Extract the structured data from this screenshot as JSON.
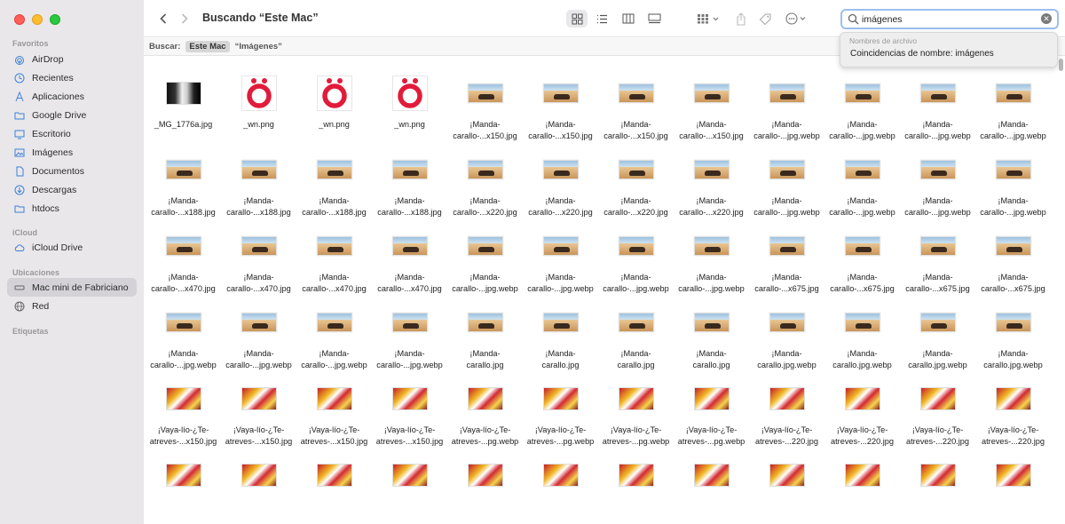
{
  "window": {
    "title": "Buscando “Este Mac”"
  },
  "sidebar": {
    "sections": [
      {
        "label": "Favoritos"
      },
      {
        "label": "iCloud"
      },
      {
        "label": "Ubicaciones"
      },
      {
        "label": "Etiquetas"
      }
    ],
    "favorites": [
      {
        "label": "AirDrop",
        "icon": "airdrop-icon"
      },
      {
        "label": "Recientes",
        "icon": "clock-icon"
      },
      {
        "label": "Aplicaciones",
        "icon": "applications-icon"
      },
      {
        "label": "Google Drive",
        "icon": "folder-icon"
      },
      {
        "label": "Escritorio",
        "icon": "desktop-icon"
      },
      {
        "label": "Imágenes",
        "icon": "photo-icon"
      },
      {
        "label": "Documentos",
        "icon": "document-icon"
      },
      {
        "label": "Descargas",
        "icon": "download-icon"
      },
      {
        "label": "htdocs",
        "icon": "folder-icon"
      }
    ],
    "icloud": [
      {
        "label": "iCloud Drive",
        "icon": "cloud-icon"
      }
    ],
    "locations": [
      {
        "label": "Mac mini de Fabriciano",
        "icon": "mac-mini-icon",
        "selected": true
      },
      {
        "label": "Red",
        "icon": "network-icon"
      }
    ]
  },
  "search": {
    "value": "imágenes",
    "suggestion_header": "Nombres de archivo",
    "suggestion": "Coincidencias de nombre: imágenes"
  },
  "scope": {
    "label": "Buscar:",
    "selected": "Este Mac",
    "option": "“Imágenes”"
  },
  "files": [
    {
      "name": "_MG_1776a.jpg",
      "thumb": "face"
    },
    {
      "name": "_wn.png",
      "thumb": "o"
    },
    {
      "name": "_wn.png",
      "thumb": "o"
    },
    {
      "name": "_wn.png",
      "thumb": "o"
    },
    {
      "name": "¡Manda-\ncarallo-...x150.jpg",
      "thumb": "desert"
    },
    {
      "name": "¡Manda-\ncarallo-...x150.jpg",
      "thumb": "desert"
    },
    {
      "name": "¡Manda-\ncarallo-...x150.jpg",
      "thumb": "desert"
    },
    {
      "name": "¡Manda-\ncarallo-...x150.jpg",
      "thumb": "desert"
    },
    {
      "name": "¡Manda-\ncarallo-...jpg.webp",
      "thumb": "desert"
    },
    {
      "name": "¡Manda-\ncarallo-...jpg.webp",
      "thumb": "desert"
    },
    {
      "name": "¡Manda-\ncarallo-...jpg.webp",
      "thumb": "desert"
    },
    {
      "name": "¡Manda-\ncarallo-...jpg.webp",
      "thumb": "desert"
    },
    {
      "name": "¡Manda-\ncarallo-...x188.jpg",
      "thumb": "desert"
    },
    {
      "name": "¡Manda-\ncarallo-...x188.jpg",
      "thumb": "desert"
    },
    {
      "name": "¡Manda-\ncarallo-...x188.jpg",
      "thumb": "desert"
    },
    {
      "name": "¡Manda-\ncarallo-...x188.jpg",
      "thumb": "desert"
    },
    {
      "name": "¡Manda-\ncarallo-...x220.jpg",
      "thumb": "desert"
    },
    {
      "name": "¡Manda-\ncarallo-...x220.jpg",
      "thumb": "desert"
    },
    {
      "name": "¡Manda-\ncarallo-...x220.jpg",
      "thumb": "desert"
    },
    {
      "name": "¡Manda-\ncarallo-...x220.jpg",
      "thumb": "desert"
    },
    {
      "name": "¡Manda-\ncarallo-...jpg.webp",
      "thumb": "desert"
    },
    {
      "name": "¡Manda-\ncarallo-...jpg.webp",
      "thumb": "desert"
    },
    {
      "name": "¡Manda-\ncarallo-...jpg.webp",
      "thumb": "desert"
    },
    {
      "name": "¡Manda-\ncarallo-...jpg.webp",
      "thumb": "desert"
    },
    {
      "name": "¡Manda-\ncarallo-...x470.jpg",
      "thumb": "desert"
    },
    {
      "name": "¡Manda-\ncarallo-...x470.jpg",
      "thumb": "desert"
    },
    {
      "name": "¡Manda-\ncarallo-...x470.jpg",
      "thumb": "desert"
    },
    {
      "name": "¡Manda-\ncarallo-...x470.jpg",
      "thumb": "desert"
    },
    {
      "name": "¡Manda-\ncarallo-...jpg.webp",
      "thumb": "desert"
    },
    {
      "name": "¡Manda-\ncarallo-...jpg.webp",
      "thumb": "desert"
    },
    {
      "name": "¡Manda-\ncarallo-...jpg.webp",
      "thumb": "desert"
    },
    {
      "name": "¡Manda-\ncarallo-...jpg.webp",
      "thumb": "desert"
    },
    {
      "name": "¡Manda-\ncarallo-...x675.jpg",
      "thumb": "desert"
    },
    {
      "name": "¡Manda-\ncarallo-...x675.jpg",
      "thumb": "desert"
    },
    {
      "name": "¡Manda-\ncarallo-...x675.jpg",
      "thumb": "desert"
    },
    {
      "name": "¡Manda-\ncarallo-...x675.jpg",
      "thumb": "desert"
    },
    {
      "name": "¡Manda-\ncarallo-...jpg.webp",
      "thumb": "desert"
    },
    {
      "name": "¡Manda-\ncarallo-...jpg.webp",
      "thumb": "desert"
    },
    {
      "name": "¡Manda-\ncarallo-...jpg.webp",
      "thumb": "desert"
    },
    {
      "name": "¡Manda-\ncarallo-...jpg.webp",
      "thumb": "desert"
    },
    {
      "name": "¡Manda-\ncarallo.jpg",
      "thumb": "desert"
    },
    {
      "name": "¡Manda-\ncarallo.jpg",
      "thumb": "desert"
    },
    {
      "name": "¡Manda-\ncarallo.jpg",
      "thumb": "desert"
    },
    {
      "name": "¡Manda-\ncarallo.jpg",
      "thumb": "desert"
    },
    {
      "name": "¡Manda-\ncarallo.jpg.webp",
      "thumb": "desert"
    },
    {
      "name": "¡Manda-\ncarallo.jpg.webp",
      "thumb": "desert"
    },
    {
      "name": "¡Manda-\ncarallo.jpg.webp",
      "thumb": "desert"
    },
    {
      "name": "¡Manda-\ncarallo.jpg.webp",
      "thumb": "desert"
    },
    {
      "name": "¡Vaya-lío-¿Te-\natreves-...x150.jpg",
      "thumb": "comic"
    },
    {
      "name": "¡Vaya-lío-¿Te-\natreves-...x150.jpg",
      "thumb": "comic"
    },
    {
      "name": "¡Vaya-lío-¿Te-\natreves-...x150.jpg",
      "thumb": "comic"
    },
    {
      "name": "¡Vaya-lío-¿Te-\natreves-...x150.jpg",
      "thumb": "comic"
    },
    {
      "name": "¡Vaya-lío-¿Te-\natreves-...pg.webp",
      "thumb": "comic"
    },
    {
      "name": "¡Vaya-lío-¿Te-\natreves-...pg.webp",
      "thumb": "comic"
    },
    {
      "name": "¡Vaya-lío-¿Te-\natreves-...pg.webp",
      "thumb": "comic"
    },
    {
      "name": "¡Vaya-lío-¿Te-\natreves-...pg.webp",
      "thumb": "comic"
    },
    {
      "name": "¡Vaya-lío-¿Te-\natreves-...220.jpg",
      "thumb": "comic"
    },
    {
      "name": "¡Vaya-lío-¿Te-\natreves-...220.jpg",
      "thumb": "comic"
    },
    {
      "name": "¡Vaya-lío-¿Te-\natreves-...220.jpg",
      "thumb": "comic"
    },
    {
      "name": "¡Vaya-lío-¿Te-\natreves-...220.jpg",
      "thumb": "comic"
    },
    {
      "name": "",
      "thumb": "comic"
    },
    {
      "name": "",
      "thumb": "comic"
    },
    {
      "name": "",
      "thumb": "comic"
    },
    {
      "name": "",
      "thumb": "comic"
    },
    {
      "name": "",
      "thumb": "comic"
    },
    {
      "name": "",
      "thumb": "comic"
    },
    {
      "name": "",
      "thumb": "comic"
    },
    {
      "name": "",
      "thumb": "comic"
    },
    {
      "name": "",
      "thumb": "comic"
    },
    {
      "name": "",
      "thumb": "comic"
    },
    {
      "name": "",
      "thumb": "comic"
    },
    {
      "name": "",
      "thumb": "comic"
    }
  ],
  "colors": {
    "sidebar_bg": "#e9e7ea",
    "selection_bg": "#d4d2d6",
    "accent_icon": "#3b82d8",
    "search_focus": "#9bbfef",
    "ring_red": "#e21b3a"
  }
}
